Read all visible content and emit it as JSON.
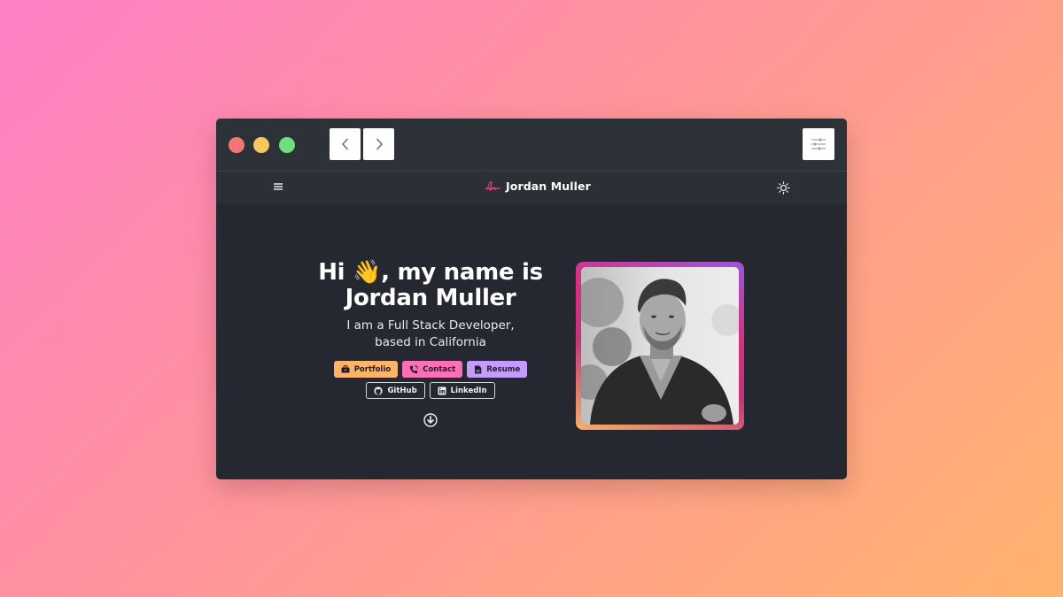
{
  "window": {
    "controls": [
      "close",
      "minimize",
      "maximize"
    ],
    "back_icon": "chevron-left-icon",
    "forward_icon": "chevron-right-icon",
    "settings_icon": "sliders-icon"
  },
  "site_nav": {
    "menu_icon": "hamburger-menu-icon",
    "brand_icon": "signature-logo-icon",
    "brand_name": "Jordan Muller",
    "theme_icon": "sun-icon"
  },
  "hero": {
    "greeting_prefix": "Hi",
    "wave_emoji": "👋",
    "greeting_suffix": ", my name is",
    "name": "Jordan Muller",
    "tagline_line1": "I am a Full Stack Developer,",
    "tagline_line2": "based in California",
    "buttons": [
      {
        "label": "Portfolio",
        "icon": "briefcase-icon",
        "color": "#fcb36a"
      },
      {
        "label": "Contact",
        "icon": "phone-icon",
        "color": "#ff6fb8"
      },
      {
        "label": "Resume",
        "icon": "document-icon",
        "color": "#c49bff"
      }
    ],
    "social": [
      {
        "label": "GitHub",
        "icon": "github-icon"
      },
      {
        "label": "LinkedIn",
        "icon": "linkedin-icon"
      }
    ],
    "scroll_icon": "arrow-down-circle-icon"
  },
  "profile": {
    "photo": "portrait-photo"
  },
  "colors": {
    "background_gradient": [
      "#ff7fc6",
      "#ffb36e"
    ],
    "window_bg": "#252830",
    "titlebar_bg": "#2d3238",
    "accent_orange": "#fcb36a",
    "accent_pink": "#ff6fb8",
    "accent_purple": "#c49bff"
  }
}
